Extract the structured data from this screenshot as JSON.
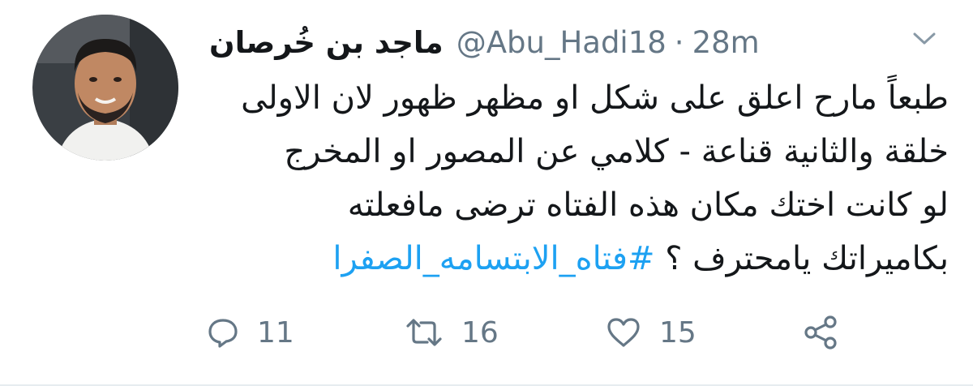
{
  "tweet": {
    "display_name": "ماجد بن خُرصان",
    "handle": "@Abu_Hadi18",
    "separator": "·",
    "time": "28m",
    "body_lines": [
      "طبعاً مارح اعلق على شكل او مظهر ظهور لان الاولى",
      "خلقة والثانية قناعة - كلامي عن المصور او المخرج",
      "لو كانت اختك مكان هذه الفتاه ترضى مافعلته",
      "بكاميراتك يامحترف ؟ "
    ],
    "hashtag": "#فتاه_الابتسامه_الصفرا",
    "actions": {
      "reply_icon": "reply-icon",
      "reply_count": "11",
      "retweet_icon": "retweet-icon",
      "retweet_count": "16",
      "like_icon": "heart-icon",
      "like_count": "15",
      "share_icon": "share-icon"
    }
  },
  "colors": {
    "text": "#14171a",
    "secondary": "#657786",
    "accent": "#1da1f2",
    "border": "#e6ecf0"
  }
}
